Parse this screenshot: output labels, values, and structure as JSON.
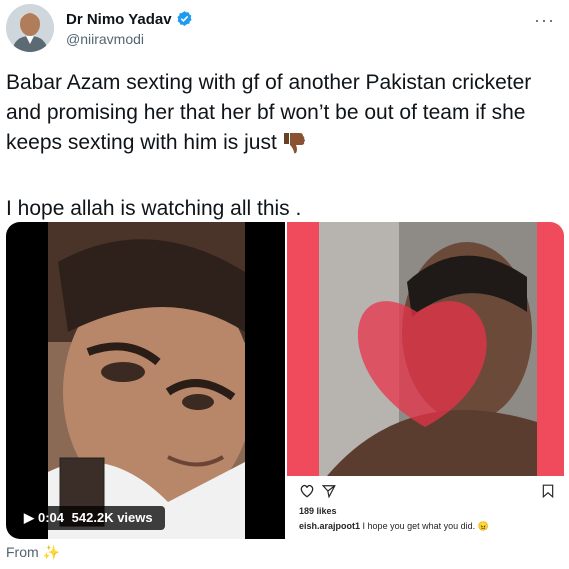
{
  "author": {
    "display_name": "Dr Nimo Yadav",
    "handle": "@niiravmodi"
  },
  "tweet": {
    "line1": "Babar Azam sexting with gf of another Pakistan cricketer and promising her that her bf won’t be out of team if she keeps sexting with him is just",
    "line2": "I hope allah is watching all this ."
  },
  "video": {
    "time": "0:04",
    "views": "542.2K views"
  },
  "instagram": {
    "likes": "189 likes",
    "username": "eish.arajpoot1",
    "comment": "I hope you get what you did."
  },
  "footer": {
    "from": "From"
  },
  "colors": {
    "verified": "#1d9bf0",
    "secondary_text": "#536471",
    "heart": "#e8334a",
    "ig_frame": "#ef4b5c"
  }
}
